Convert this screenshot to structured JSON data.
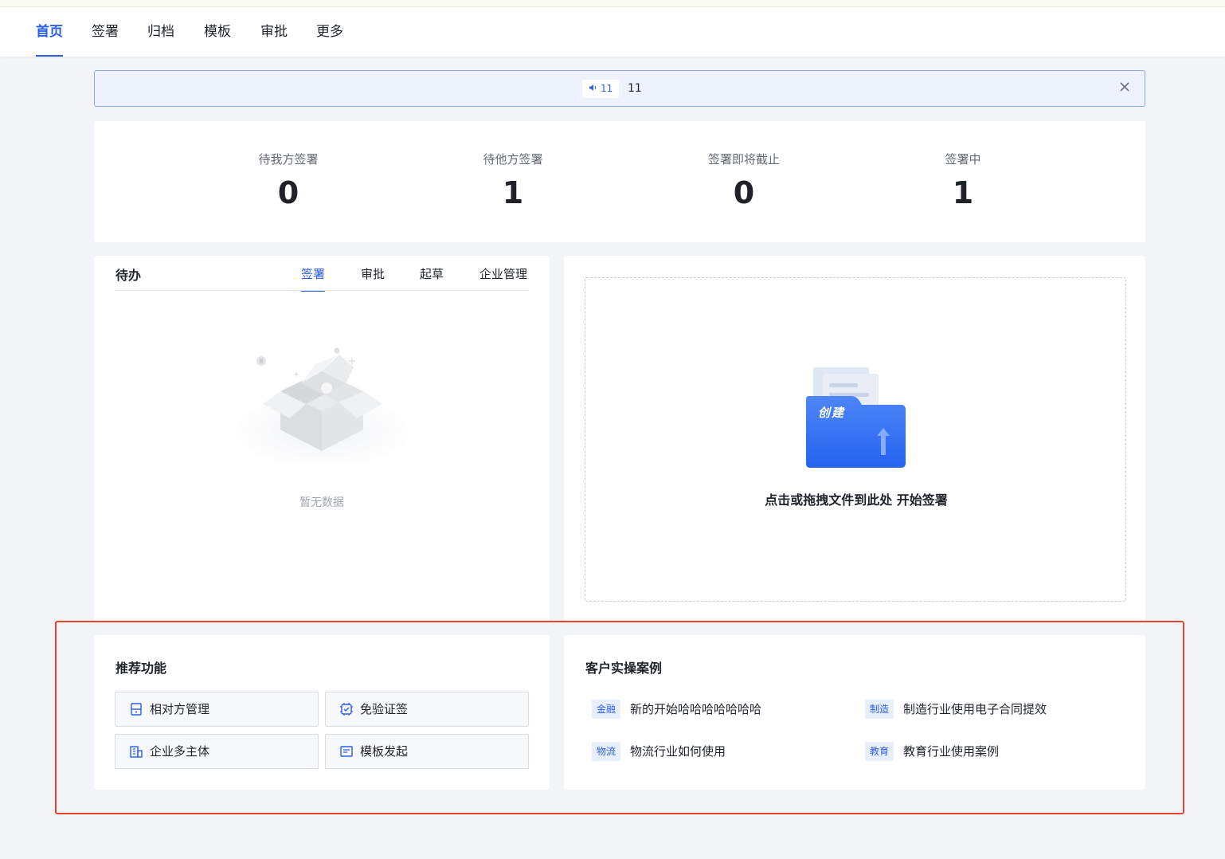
{
  "nav": {
    "tabs": [
      {
        "label": "首页",
        "active": true
      },
      {
        "label": "签署"
      },
      {
        "label": "归档"
      },
      {
        "label": "模板"
      },
      {
        "label": "审批"
      },
      {
        "label": "更多"
      }
    ]
  },
  "notice": {
    "tag": "11",
    "text": "11",
    "close_icon": "close-icon"
  },
  "stats": [
    {
      "label": "待我方签署",
      "value": "0"
    },
    {
      "label": "待他方签署",
      "value": "1"
    },
    {
      "label": "签署即将截止",
      "value": "0"
    },
    {
      "label": "签署中",
      "value": "1"
    }
  ],
  "todo": {
    "title": "待办",
    "tabs": [
      "签署",
      "审批",
      "起草",
      "企业管理"
    ],
    "active_tab": "签署",
    "empty_text": "暂无数据"
  },
  "upload": {
    "folder_label": "创建",
    "text": "点击或拖拽文件到此处 开始签署"
  },
  "recommend": {
    "title": "推荐功能",
    "items": [
      {
        "label": "相对方管理",
        "icon": "contacts-icon"
      },
      {
        "label": "免验证签",
        "icon": "verified-seal-icon"
      },
      {
        "label": "企业多主体",
        "icon": "enterprise-icon"
      },
      {
        "label": "模板发起",
        "icon": "template-icon"
      }
    ]
  },
  "cases": {
    "title": "客户实操案例",
    "items": [
      {
        "tag": "金融",
        "text": "新的开始哈哈哈哈哈哈哈"
      },
      {
        "tag": "制造",
        "text": "制造行业使用电子合同提效"
      },
      {
        "tag": "物流",
        "text": "物流行业如何使用"
      },
      {
        "tag": "教育",
        "text": "教育行业使用案例"
      }
    ]
  },
  "colors": {
    "accent": "#2a5ee8",
    "highlight": "#e8432d"
  }
}
